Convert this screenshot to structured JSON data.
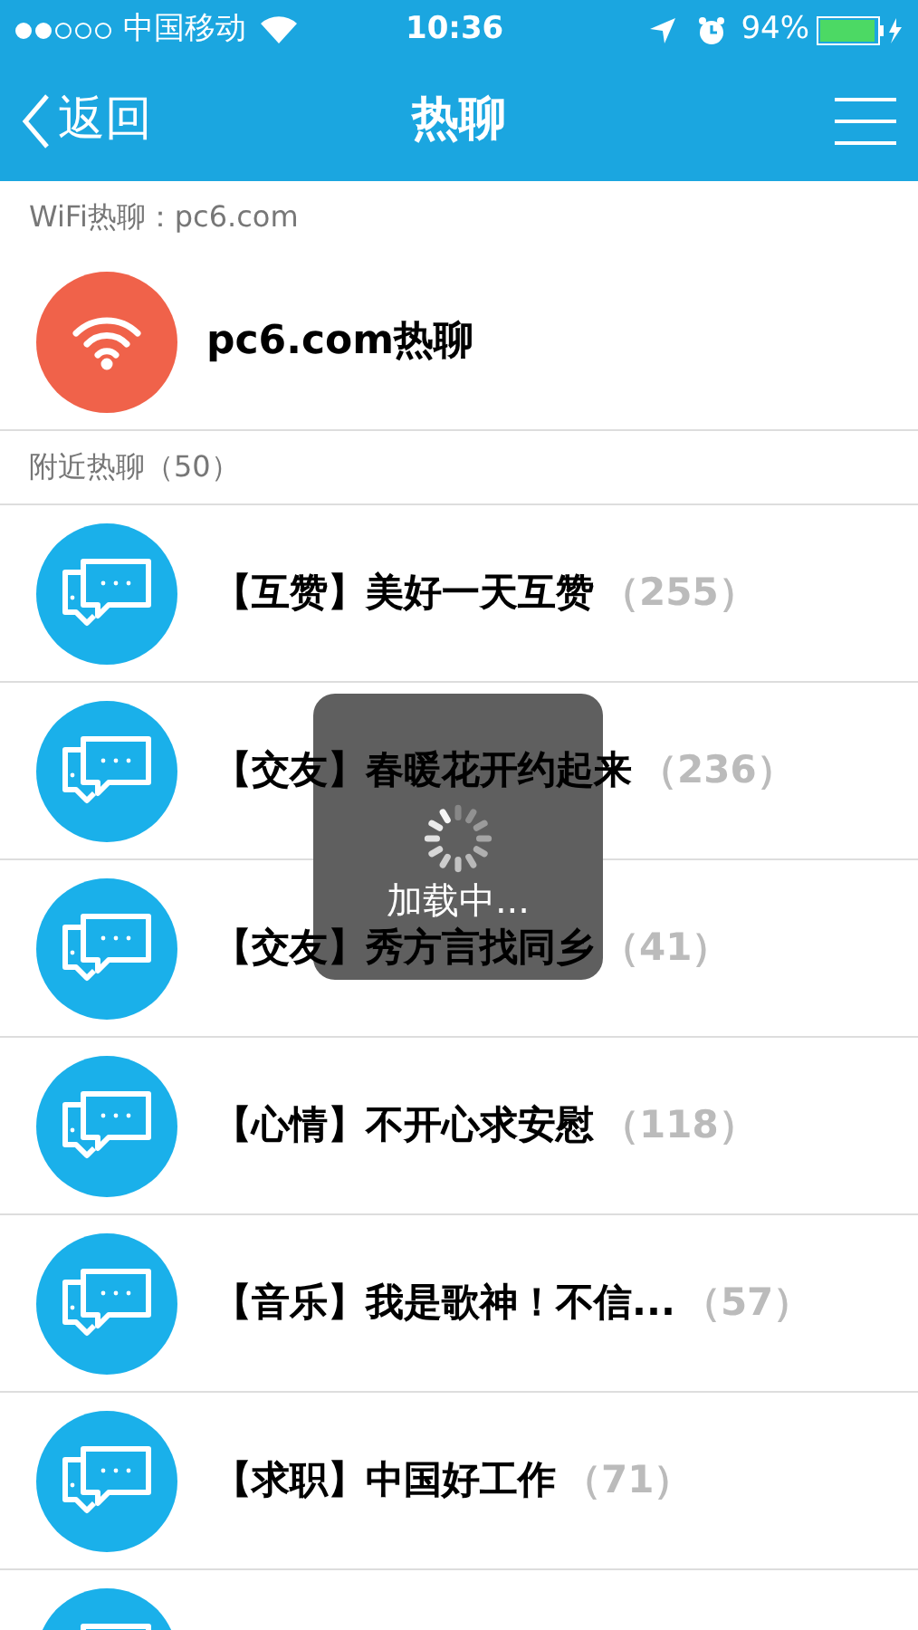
{
  "status_bar": {
    "carrier": "中国移动",
    "time": "10:36",
    "battery": "94%"
  },
  "nav": {
    "back": "返回",
    "title": "热聊"
  },
  "wifi_section": {
    "header": "WiFi热聊：pc6.com",
    "item": "pc6.com热聊"
  },
  "nearby_section": {
    "header": "附近热聊（50）",
    "rows": [
      {
        "kind": "room",
        "title": "【互赞】美好一天互赞",
        "count": "（255）"
      },
      {
        "kind": "room",
        "title": "【交友】春暖花开约起来",
        "count": "（236）"
      },
      {
        "kind": "room",
        "title": "【交友】秀方言找同乡",
        "count": "（41）"
      },
      {
        "kind": "room",
        "title": "【心情】不开心求安慰",
        "count": "（118）"
      },
      {
        "kind": "room",
        "title": "【音乐】我是歌神！不信...",
        "count": "（57）"
      },
      {
        "kind": "room",
        "title": "【求职】中国好工作",
        "count": "（71）"
      },
      {
        "kind": "partial"
      }
    ]
  },
  "loading": {
    "text": "加载中..."
  }
}
